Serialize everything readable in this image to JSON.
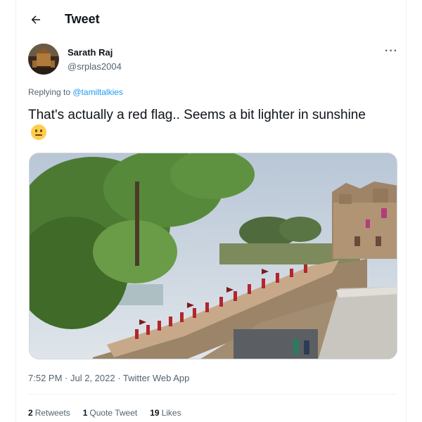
{
  "header": {
    "title": "Tweet",
    "back_icon": "arrow-left-icon"
  },
  "author": {
    "name": "Sarath Raj",
    "handle": "@srplas2004",
    "more_icon": "more-horizontal-icon"
  },
  "reply": {
    "prefix": "Replying to ",
    "handle": "@tamiltalkies"
  },
  "tweet": {
    "text": "That's actually a red flag.. Seems a bit lighter in sunshine",
    "emoji_icon": "slightly-frowning-face-icon"
  },
  "media": {
    "icon": "photo-procession-palace"
  },
  "meta": {
    "time": "7:52 PM",
    "sep1": " · ",
    "date": "Jul 2, 2022",
    "sep2": " · ",
    "app": "Twitter Web App"
  },
  "stats": {
    "retweets_count": "2",
    "retweets_label": "Retweets",
    "quotes_count": "1",
    "quotes_label": "Quote Tweet",
    "likes_count": "19",
    "likes_label": "Likes"
  },
  "colors": {
    "accent": "#1d9bf0",
    "text": "#0f1419",
    "secondary": "#536471",
    "border": "#eff3f4"
  }
}
